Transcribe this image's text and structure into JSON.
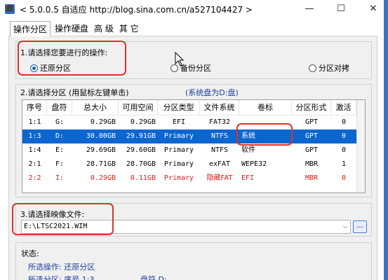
{
  "window": {
    "title": "< 5.0.0.5 自适应 http://blog.sina.com.cn/a527104427 >",
    "icon": "app-icon",
    "min_glyph": "—",
    "max_glyph": "☐",
    "close_glyph": "✕"
  },
  "tabs": [
    {
      "label": "操作分区",
      "active": true
    },
    {
      "label": "操作硬盘"
    },
    {
      "label": "高 级"
    },
    {
      "label": "其 它"
    }
  ],
  "operation": {
    "prompt": "1.请选择您要进行的操作:",
    "options": [
      {
        "label": "还原分区",
        "selected": true
      },
      {
        "label": "备份分区",
        "selected": false
      },
      {
        "label": "分区对拷",
        "selected": false
      }
    ]
  },
  "partition": {
    "prompt": "2.请选择分区 (用鼠标左键单击)",
    "system_hint": "(系统盘为D:盘)",
    "columns": [
      "序号",
      "盘符",
      "总大小",
      "可用空间",
      "分区类型",
      "文件系统",
      "卷标",
      "分区形式",
      "激活"
    ],
    "rows": [
      {
        "idx": "1:1",
        "drive": "G:",
        "total": "0.29GB",
        "free": "0.29GB",
        "ptype": "EFI",
        "fs": "FAT32",
        "label": "",
        "style": "GPT",
        "active": "0",
        "state": "normal"
      },
      {
        "idx": "1:3",
        "drive": "D:",
        "total": "30.00GB",
        "free": "29.91GB",
        "ptype": "Primary",
        "fs": "NTFS",
        "label": "系统",
        "style": "GPT",
        "active": "0",
        "state": "selected"
      },
      {
        "idx": "1:4",
        "drive": "E:",
        "total": "29.69GB",
        "free": "29.60GB",
        "ptype": "Primary",
        "fs": "NTFS",
        "label": "软件",
        "style": "GPT",
        "active": "0",
        "state": "normal"
      },
      {
        "idx": "2:1",
        "drive": "F:",
        "total": "28.71GB",
        "free": "28.70GB",
        "ptype": "Primary",
        "fs": "exFAT",
        "label": "WEPE32",
        "style": "MBR",
        "active": "1",
        "state": "normal"
      },
      {
        "idx": "2:2",
        "drive": "I:",
        "total": "0.29GB",
        "free": "0.11GB",
        "ptype": "Primary",
        "fs": "隐藏FAT",
        "label": "EFI",
        "style": "MBR",
        "active": "0",
        "state": "red"
      }
    ]
  },
  "image": {
    "prompt": "3.请选择映像文件:",
    "path": "E:\\LTSC2021.WIM",
    "browse_label": "..."
  },
  "status": {
    "heading": "状态:",
    "line1": "所选操作: 还原分区",
    "line2_a": "所选分区:  序号 1:3",
    "line2_b": "盘符 D:"
  }
}
